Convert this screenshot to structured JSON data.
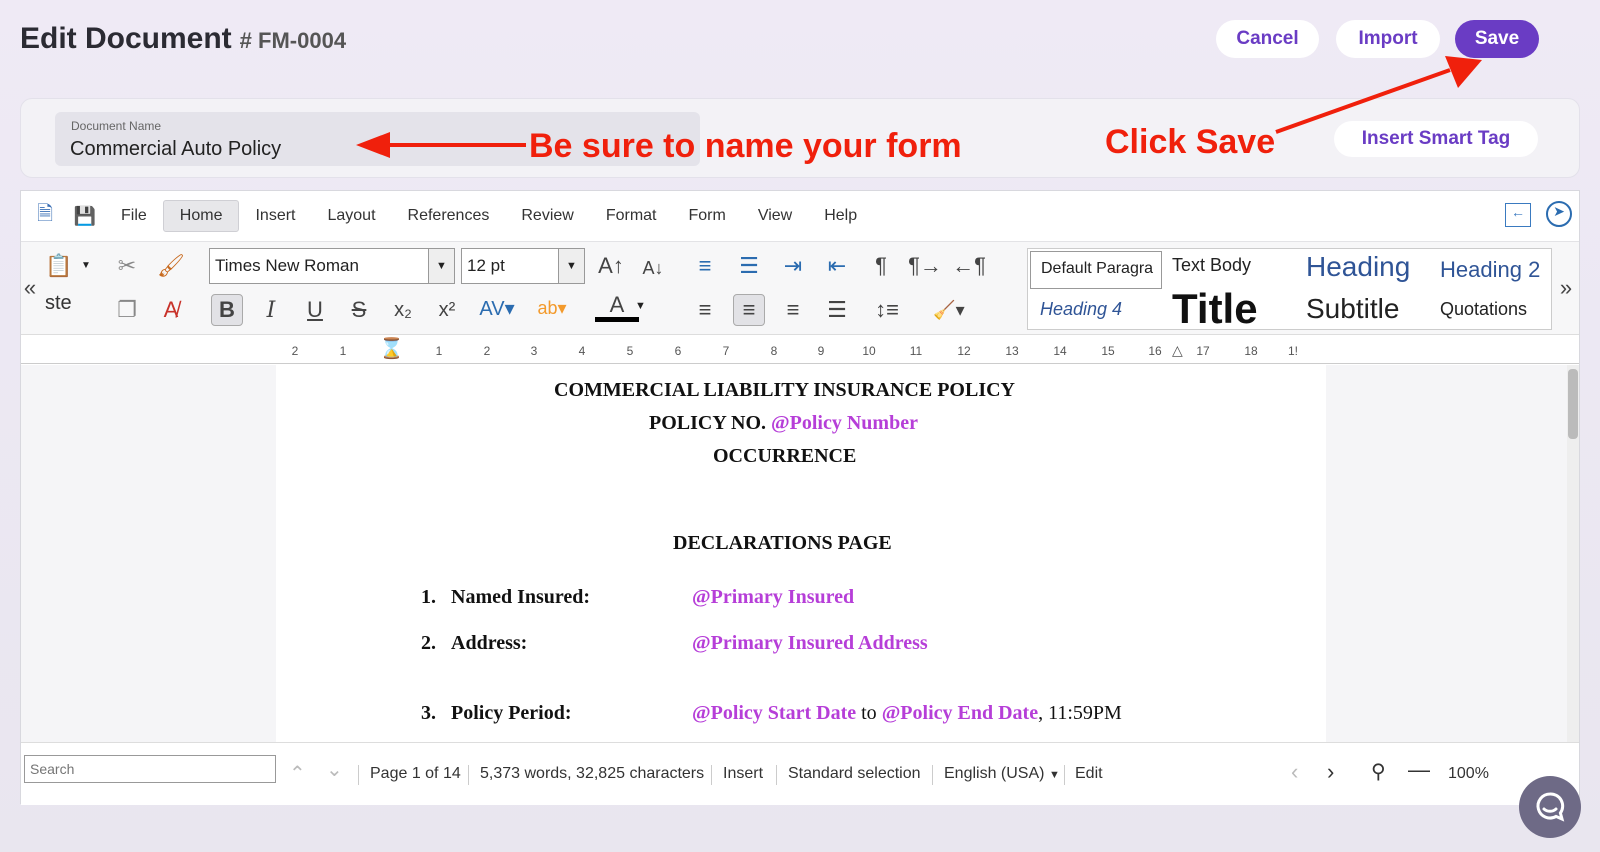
{
  "header": {
    "title": "Edit Document",
    "doc_number": "# FM-0004"
  },
  "actions": {
    "cancel": "Cancel",
    "import": "Import",
    "save": "Save"
  },
  "name_field": {
    "label": "Document Name",
    "value": "Commercial Auto Policy"
  },
  "smart_tag": "Insert Smart Tag",
  "annotations": {
    "name_hint": "Be sure to name your form",
    "save_hint": "Click Save",
    "color": "#f0200c"
  },
  "menu": [
    "File",
    "Home",
    "Insert",
    "Layout",
    "References",
    "Review",
    "Format",
    "Form",
    "View",
    "Help"
  ],
  "ribbon": {
    "paste": "ste",
    "font": "Times New Roman",
    "size": "12 pt"
  },
  "styles": {
    "default": "Default Paragra",
    "text_body": "Text Body",
    "heading": "Heading",
    "heading2": "Heading 2",
    "heading4": "Heading 4",
    "title": "Title",
    "subtitle": "Subtitle",
    "quotations": "Quotations"
  },
  "ruler_ticks": [
    "2",
    "1",
    "1",
    "2",
    "3",
    "4",
    "5",
    "6",
    "7",
    "8",
    "9",
    "10",
    "11",
    "12",
    "13",
    "14",
    "15",
    "16",
    "17",
    "18",
    "1!"
  ],
  "document": {
    "title": "COMMERCIAL LIABILITY INSURANCE POLICY",
    "policy_no_label": "POLICY NO.",
    "policy_no_tag": "@Policy Number",
    "occurrence": "OCCURRENCE",
    "declarations": "DECLARATIONS PAGE",
    "items": [
      {
        "num": "1.",
        "label": "Named Insured:",
        "tag": "@Primary Insured"
      },
      {
        "num": "2.",
        "label": "Address:",
        "tag": "@Primary Insured Address"
      },
      {
        "num": "3.",
        "label": "Policy Period:",
        "tag": "@Policy Start Date",
        "mid": "to",
        "tag2": "@Policy End Date",
        "tail": ", 11:59PM"
      }
    ]
  },
  "status": {
    "search_placeholder": "Search",
    "page": "Page 1 of 14",
    "words": "5,373 words, 32,825 characters",
    "mode": "Insert",
    "selection": "Standard selection",
    "language": "English (USA)",
    "edit": "Edit",
    "zoom": "100%"
  },
  "colors": {
    "accent": "#6a3cc4",
    "tag": "#b63ed8"
  }
}
